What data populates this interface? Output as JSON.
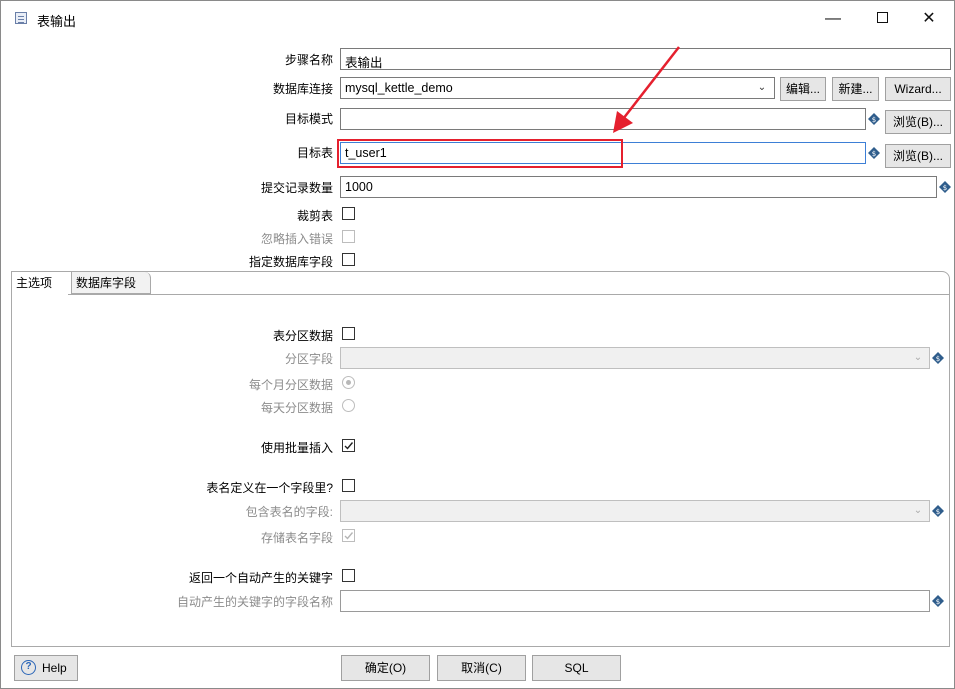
{
  "window": {
    "title": "表输出",
    "controls": {
      "minimize": "—",
      "close": "✕"
    }
  },
  "form": {
    "step_name_label": "步骤名称",
    "step_name_value": "表输出",
    "db_conn_label": "数据库连接",
    "db_conn_value": "mysql_kettle_demo",
    "edit_btn": "编辑...",
    "new_btn": "新建...",
    "wizard_btn": "Wizard...",
    "target_schema_label": "目标模式",
    "target_schema_value": "",
    "browse_btn_1": "浏览(B)...",
    "target_table_label": "目标表",
    "target_table_value": "t_user1",
    "browse_btn_2": "浏览(B)...",
    "commit_size_label": "提交记录数量",
    "commit_size_value": "1000",
    "truncate_label": "裁剪表",
    "ignore_errors_label": "忽略插入错误",
    "specify_fields_label": "指定数据库字段"
  },
  "tabs": [
    {
      "label": "主选项",
      "active": true
    },
    {
      "label": "数据库字段",
      "active": false
    }
  ],
  "main_tab": {
    "partition_label": "表分区数据",
    "partition_field_label": "分区字段",
    "monthly_label": "每个月分区数据",
    "daily_label": "每天分区数据",
    "batch_label": "使用批量插入",
    "table_in_field_label": "表名定义在一个字段里?",
    "table_name_field_label": "包含表名的字段:",
    "store_table_name_label": "存储表名字段",
    "return_key_label": "返回一个自动产生的关键字",
    "key_field_name_label": "自动产生的关键字的字段名称"
  },
  "footer": {
    "help": "Help",
    "ok": "确定(O)",
    "cancel": "取消(C)",
    "sql": "SQL"
  },
  "colors": {
    "highlight": "#e5202e",
    "active_border": "#3d7fd6",
    "variable_icon": "#2f5d8c"
  }
}
